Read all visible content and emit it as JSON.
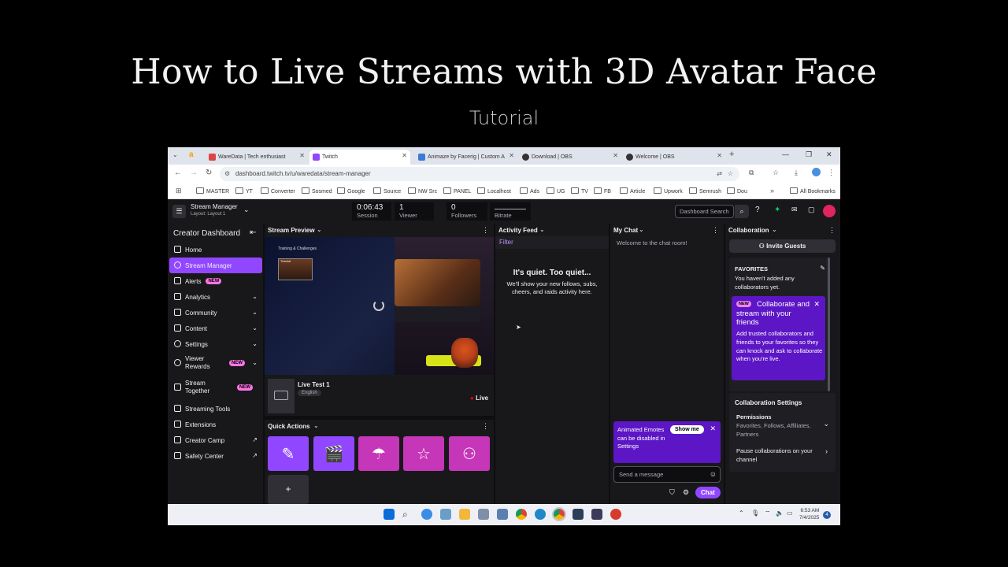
{
  "video": {
    "title": "How to Live Streams with 3D Avatar Face",
    "subtitle": "Tutorial"
  },
  "browser": {
    "tabs": [
      {
        "label": "WareData | Tech enthusiast",
        "color": "#d44"
      },
      {
        "label": "Twitch",
        "color": "#9147ff"
      },
      {
        "label": "Animaze by Facerig | Custom A",
        "color": "#3a7bd5"
      },
      {
        "label": "Download | OBS",
        "color": "#333"
      },
      {
        "label": "Welcome | OBS",
        "color": "#333"
      }
    ],
    "url": "dashboard.twitch.tv/u/waredata/stream-manager",
    "bookmarks": [
      "MASTER",
      "YT",
      "Converter",
      "Sosmed",
      "Google",
      "Source",
      "NW Src",
      "PANEL",
      "Localhost",
      "Ads",
      "UG",
      "TV",
      "FB",
      "Article",
      "Upwork",
      "Semrush",
      "Dou"
    ],
    "all_bookmarks": "All Bookmarks"
  },
  "header": {
    "title": "Stream Manager",
    "layout": "Layout: Layout 1",
    "stats": [
      {
        "value": "0:06:43",
        "label": "Session"
      },
      {
        "value": "1",
        "label": "Viewer"
      },
      {
        "value": "0",
        "label": "Followers"
      },
      {
        "value": "",
        "label": "Bitrate"
      }
    ],
    "search_placeholder": "Dashboard Search"
  },
  "sidebar": {
    "title": "Creator Dashboard",
    "items": [
      {
        "label": "Home"
      },
      {
        "label": "Stream Manager"
      },
      {
        "label": "Alerts",
        "badge": "NEW"
      },
      {
        "label": "Analytics"
      },
      {
        "label": "Community"
      },
      {
        "label": "Content"
      },
      {
        "label": "Settings"
      },
      {
        "label": "Viewer Rewards",
        "badge": "NEW"
      },
      {
        "label": "Stream Together",
        "badge": "NEW"
      },
      {
        "label": "Streaming Tools"
      },
      {
        "label": "Extensions"
      },
      {
        "label": "Creator Camp"
      },
      {
        "label": "Safety Center"
      }
    ]
  },
  "preview": {
    "header": "Stream Preview",
    "scene_title": "Training & Challenges",
    "scene_tag": "Tutorial",
    "stream_title": "Live Test 1",
    "language": "English",
    "live": "Live"
  },
  "quick_actions": {
    "header": "Quick Actions",
    "add": "+"
  },
  "activity": {
    "header": "Activity Feed",
    "filter": "Filter",
    "empty_title": "It's quiet. Too quiet...",
    "empty_body": "We'll show your new follows, subs, cheers, and raids activity here."
  },
  "chat": {
    "header": "My Chat",
    "welcome": "Welcome to the chat room!",
    "tip": "Animated Emotes can be disabled in Settings",
    "show_me": "Show me",
    "placeholder": "Send a message",
    "send": "Chat"
  },
  "collab": {
    "header": "Collaboration",
    "invite": "Invite Guests",
    "favorites_title": "FAVORITES",
    "favorites_body": "You haven't added any collaborators yet.",
    "promo_badge": "NEW",
    "promo_title": "Collaborate and stream with your friends",
    "promo_body": "Add trusted collaborators and friends to your favorites so they can knock and ask to collaborate when you're live.",
    "settings_title": "Collaboration Settings",
    "permissions_label": "Permissions",
    "permissions_value": "Favorites, Follows, Affiliates, Partners",
    "pause_label": "Pause collaborations on your channel"
  },
  "taskbar": {
    "time": "6:53 AM",
    "date": "7/4/2025",
    "notif": "4"
  }
}
